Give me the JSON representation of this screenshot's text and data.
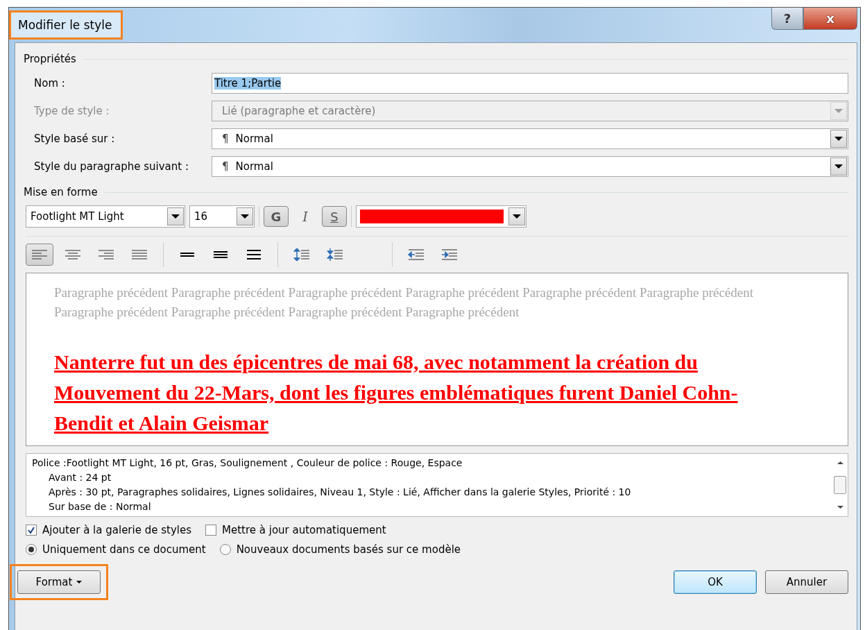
{
  "window": {
    "title": "Modifier le style",
    "title_highlighted": true,
    "help": "?",
    "close": "x"
  },
  "properties": {
    "heading": "Propriétés",
    "fields": [
      {
        "label": "Nom :",
        "kind": "text",
        "value": "Titre 1;Partie",
        "disabled": false,
        "text_selected": true
      },
      {
        "label": "Type de style :",
        "kind": "dropdown",
        "value": "Lié (paragraphe et caractère)",
        "disabled": true
      },
      {
        "label": "Style basé sur :",
        "kind": "dropdown",
        "mark": "¶",
        "value": "Normal",
        "disabled": false
      },
      {
        "label": "Style du paragraphe suivant :",
        "kind": "dropdown",
        "mark": "¶",
        "value": "Normal",
        "disabled": false
      }
    ]
  },
  "formatting": {
    "heading": "Mise en forme",
    "font": "Footlight MT Light",
    "size": "16",
    "styles": [
      {
        "label": "G",
        "kind": "bold",
        "selected": true
      },
      {
        "label": "I",
        "kind": "italic",
        "selected": false
      },
      {
        "label": "S",
        "kind": "underline",
        "selected": true
      }
    ],
    "color": "#ff0000",
    "paragraph_tools": [
      {
        "kind": "align-left",
        "selected": true
      },
      {
        "kind": "align-center",
        "selected": false
      },
      {
        "kind": "align-right",
        "selected": false
      },
      {
        "kind": "justify",
        "selected": false
      },
      {
        "kind": "separator"
      },
      {
        "kind": "spacing-single",
        "selected": false
      },
      {
        "kind": "spacing-medium",
        "selected": false
      },
      {
        "kind": "spacing-double",
        "selected": false
      },
      {
        "kind": "separator"
      },
      {
        "kind": "space-increase",
        "selected": false
      },
      {
        "kind": "space-decrease",
        "selected": false
      },
      {
        "kind": "gap"
      },
      {
        "kind": "separator"
      },
      {
        "kind": "indent-decrease",
        "selected": false
      },
      {
        "kind": "indent-increase",
        "selected": false
      }
    ]
  },
  "preview": {
    "previous": "Paragraphe précédent Paragraphe précédent Paragraphe précédent Paragraphe précédent Paragraphe précédent Paragraphe précédent Paragraphe précédent Paragraphe précédent Paragraphe précédent Paragraphe précédent",
    "sample": "Nanterre fut un des épicentres de mai 68, avec notamment la création du Mouvement du 22-Mars, dont les figures emblématiques furent Daniel Cohn-Bendit et Alain Geismar"
  },
  "description": [
    "Police :Footlight MT Light, 16 pt, Gras, Soulignement , Couleur de police : Rouge, Espace",
    "Avant : 24 pt",
    "Après : 30 pt, Paragraphes solidaires, Lignes solidaires, Niveau 1, Style : Lié, Afficher dans la galerie Styles, Priorité : 10",
    "Sur base de : Normal"
  ],
  "checkboxes": [
    {
      "label": "Ajouter à la galerie de styles",
      "checked": true
    },
    {
      "label": "Mettre à jour automatiquement",
      "checked": false
    }
  ],
  "radios": [
    {
      "label": "Uniquement dans ce document",
      "selected": true
    },
    {
      "label": "Nouveaux documents basés sur ce modèle",
      "selected": false
    }
  ],
  "format_button": {
    "label": "Format",
    "highlighted": true
  },
  "buttons": [
    "OK",
    "Annuler"
  ]
}
